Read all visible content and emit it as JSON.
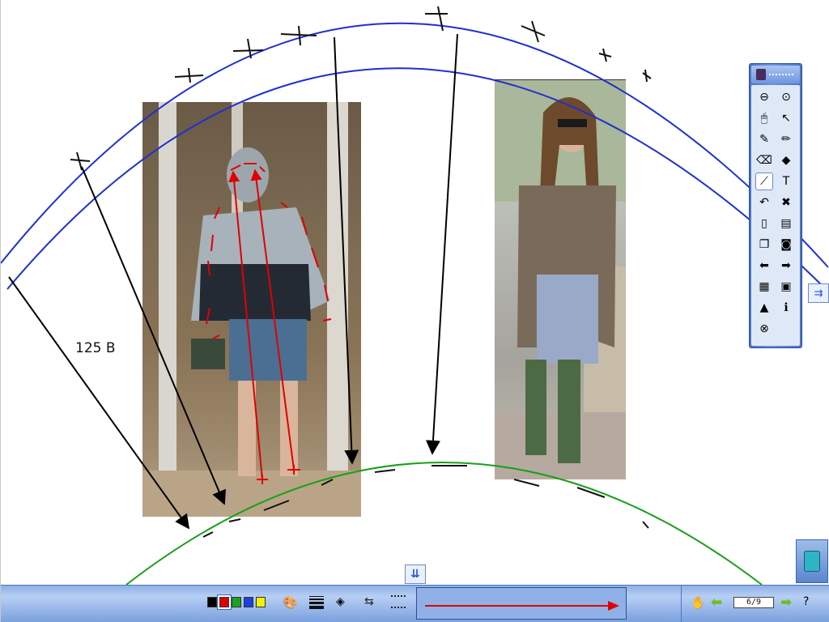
{
  "canvas": {
    "annotation_label": "125 B"
  },
  "toolbox": {
    "header_icon": "app-icon",
    "buttons": [
      {
        "name": "minimize-icon",
        "glyph": "⊖"
      },
      {
        "name": "dropdown-icon",
        "glyph": "⊙"
      },
      {
        "name": "mouse-icon",
        "glyph": "🖱"
      },
      {
        "name": "pointer-icon",
        "glyph": "↖"
      },
      {
        "name": "pen-icon",
        "glyph": "✎"
      },
      {
        "name": "highlighter-icon",
        "glyph": "✏"
      },
      {
        "name": "eraser-icon",
        "glyph": "⌫"
      },
      {
        "name": "shapes-icon",
        "glyph": "◆"
      },
      {
        "name": "line-icon",
        "glyph": "⟋"
      },
      {
        "name": "text-icon",
        "glyph": "T"
      },
      {
        "name": "undo-icon",
        "glyph": "↶"
      },
      {
        "name": "delete-icon",
        "glyph": "✖"
      },
      {
        "name": "blank-page-icon",
        "glyph": "▯"
      },
      {
        "name": "lined-page-icon",
        "glyph": "▤"
      },
      {
        "name": "duplicate-page-icon",
        "glyph": "❐"
      },
      {
        "name": "camera-icon",
        "glyph": "◙"
      },
      {
        "name": "back-arrow-icon",
        "glyph": "⬅"
      },
      {
        "name": "forward-arrow-icon",
        "glyph": "➡"
      },
      {
        "name": "grid-icon",
        "glyph": "▦"
      },
      {
        "name": "save-icon",
        "glyph": "▣"
      },
      {
        "name": "image-icon",
        "glyph": "▲"
      },
      {
        "name": "info-icon",
        "glyph": "ℹ"
      },
      {
        "name": "close-icon",
        "glyph": "⊗"
      }
    ]
  },
  "side": {
    "arrow_icon": "⇉",
    "collapse_icon": "⇊"
  },
  "colors": {
    "swatches": [
      "#000000",
      "#e00000",
      "#1aa31a",
      "#1f3fe0",
      "#f2f200"
    ],
    "selected": "#e00000",
    "blue_arc": "#1f2fd0",
    "green_arc": "#18a018",
    "annotation_red": "#e00000"
  },
  "bottom_bar": {
    "palette_icon": "🎨",
    "fill_icon": "◈",
    "arrow_style_icon": "⇆",
    "hand_icon": "✋",
    "prev_icon": "⬅",
    "next_icon": "➡",
    "help_icon": "?",
    "page_indicator": "6/9"
  }
}
